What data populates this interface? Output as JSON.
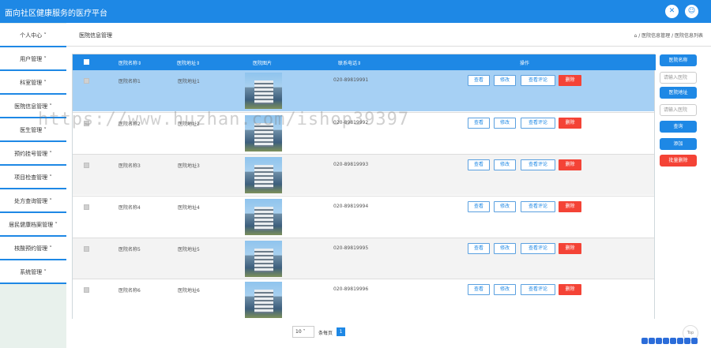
{
  "app": {
    "title": "面向社区健康服务的医疗平台"
  },
  "topbar_icons": [
    "close-icon",
    "user-icon"
  ],
  "sidebar": {
    "items": [
      {
        "label": "个人中心"
      },
      {
        "label": "用户管理"
      },
      {
        "label": "科室管理"
      },
      {
        "label": "医院信息管理"
      },
      {
        "label": "医生管理"
      },
      {
        "label": "预约挂号管理"
      },
      {
        "label": "项目检查管理"
      },
      {
        "label": "处方查询管理"
      },
      {
        "label": "居民健康档案管理"
      },
      {
        "label": "核酸预约管理"
      },
      {
        "label": "系统管理"
      }
    ]
  },
  "page": {
    "title": "医院信息管理",
    "breadcrumb": "/ 医院信息管理 / 医院信息列表"
  },
  "table": {
    "headers": [
      "医院名称",
      "医院地址",
      "医院图片",
      "联系电话",
      "操作"
    ],
    "rows": [
      {
        "name": "医院名称1",
        "address": "医院地址1",
        "phone": "020-89819991"
      },
      {
        "name": "医院名称2",
        "address": "医院地址2",
        "phone": "020-89819992"
      },
      {
        "name": "医院名称3",
        "address": "医院地址3",
        "phone": "020-89819993"
      },
      {
        "name": "医院名称4",
        "address": "医院地址4",
        "phone": "020-89819994"
      },
      {
        "name": "医院名称5",
        "address": "医院地址5",
        "phone": "020-89819995"
      },
      {
        "name": "医院名称6",
        "address": "医院地址6",
        "phone": "020-89819996"
      }
    ],
    "actions": {
      "view": "查看",
      "edit": "修改",
      "review": "查看评论",
      "delete": "删除"
    }
  },
  "search_panel": {
    "name_label": "医院名称",
    "name_placeholder": "请输入医院",
    "address_label": "医院地址",
    "address_placeholder": "请输入医院",
    "search": "查询",
    "add": "添加",
    "batch_delete": "批量删除"
  },
  "pagination": {
    "page_size": "10",
    "label": "条每页",
    "current_page": "1"
  },
  "watermark": "https://www.huzhan.com/ishop39397",
  "top_button": "Top",
  "colors": {
    "primary": "#1e88e5",
    "danger": "#f44336",
    "selected_row": "#a6d0f4"
  }
}
